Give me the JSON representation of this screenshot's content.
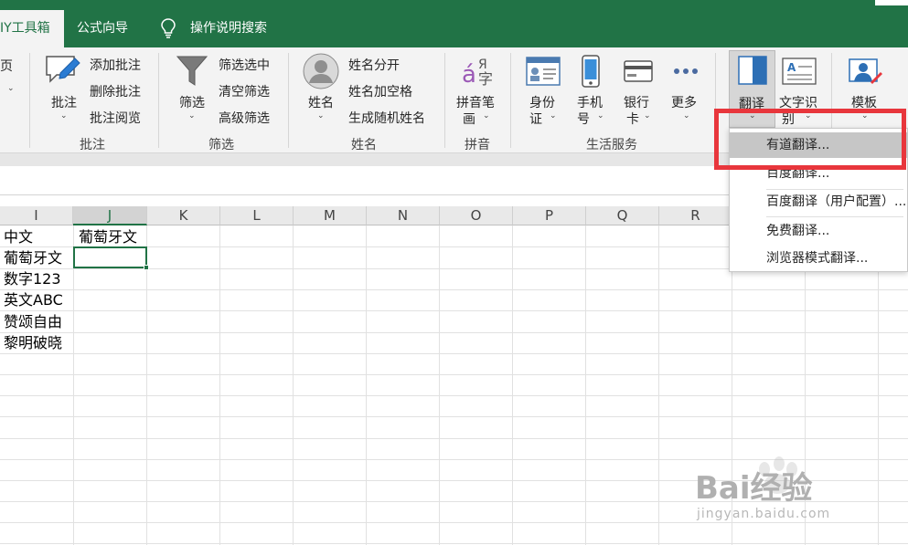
{
  "tabs": {
    "active": "IY工具箱",
    "formula_wizard": "公式向导",
    "help_search": "操作说明搜索"
  },
  "ribbon": {
    "partial_left": "页",
    "comment_group": {
      "big_button": "批注",
      "add": "添加批注",
      "delete": "删除批注",
      "review": "批注阅览",
      "group_label": "批注"
    },
    "filter_group": {
      "big_button": "筛选",
      "filter_selected": "筛选选中",
      "clear_filter": "清空筛选",
      "advanced_filter": "高级筛选",
      "group_label": "筛选"
    },
    "name_group": {
      "big_button": "姓名",
      "split": "姓名分开",
      "add_space": "姓名加空格",
      "random": "生成随机姓名",
      "group_label": "姓名"
    },
    "pinyin_group": {
      "btn_line1": "拼音笔",
      "btn_line2": "画",
      "group_label": "拼音"
    },
    "life_group": {
      "id_line1": "身份",
      "id_line2": "证",
      "phone_line1": "手机",
      "phone_line2": "号",
      "bank_line1": "银行",
      "bank_line2": "卡",
      "more": "更多",
      "group_label": "生活服务"
    },
    "translate_button": "翻译",
    "ocr_line1": "文字识",
    "ocr_line2": "别",
    "template_button": "模板"
  },
  "dropdown": {
    "items": [
      "有道翻译...",
      "百度翻译...",
      "百度翻译（用户配置）...",
      "免费翻译...",
      "浏览器模式翻译..."
    ]
  },
  "columns": [
    "I",
    "J",
    "K",
    "L",
    "M",
    "N",
    "O",
    "P",
    "Q",
    "R"
  ],
  "cells": {
    "I": [
      "中文",
      "葡萄牙文",
      "数字123",
      "英文ABC",
      "赞颂自由",
      "黎明破晓"
    ],
    "J1": "葡萄牙文"
  },
  "watermark": {
    "brand": "Bai经验",
    "url": "jingyan.baidu.com"
  },
  "colors": {
    "excel_green": "#217346",
    "highlight_red": "#e8363c"
  }
}
